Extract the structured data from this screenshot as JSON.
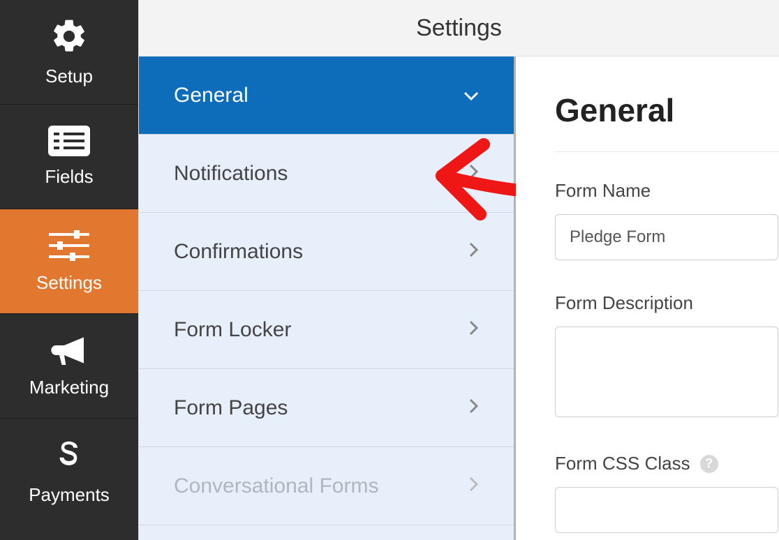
{
  "topbar": {
    "title": "Settings"
  },
  "sidebar": {
    "items": [
      {
        "label": "Setup"
      },
      {
        "label": "Fields"
      },
      {
        "label": "Settings"
      },
      {
        "label": "Marketing"
      },
      {
        "label": "Payments"
      }
    ]
  },
  "submenu": {
    "items": [
      {
        "label": "General"
      },
      {
        "label": "Notifications"
      },
      {
        "label": "Confirmations"
      },
      {
        "label": "Form Locker"
      },
      {
        "label": "Form Pages"
      },
      {
        "label": "Conversational Forms"
      }
    ]
  },
  "content": {
    "heading": "General",
    "form_name_label": "Form Name",
    "form_name_value": "Pledge Form",
    "form_description_label": "Form Description",
    "form_description_value": "",
    "form_css_label": "Form CSS Class"
  }
}
